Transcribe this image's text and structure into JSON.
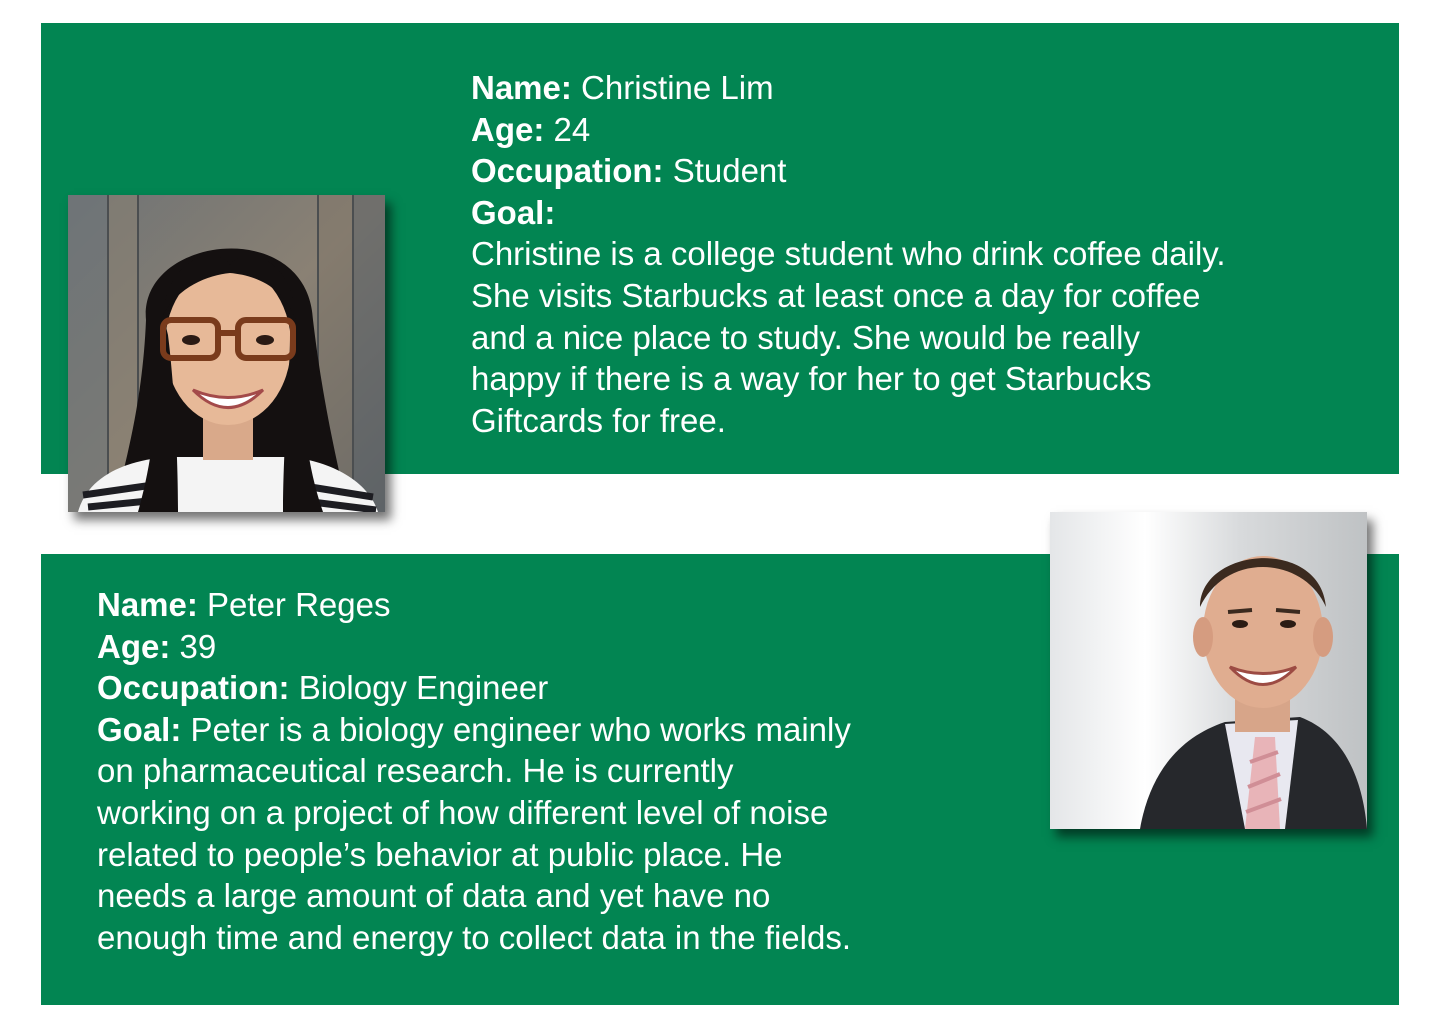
{
  "labels": {
    "name": "Name:",
    "age": "Age:",
    "occupation": "Occupation:",
    "goal": "Goal:"
  },
  "colors": {
    "card_green": "#028552",
    "text": "#ffffff"
  },
  "personas": [
    {
      "name": "Christine Lim",
      "age": "24",
      "occupation": "Student",
      "goal_lines": [
        "Christine is a college student who drink coffee daily.",
        "She visits Starbucks at least once a day for coffee",
        "and a nice place to study. She would be really",
        "happy if there is a way for her to get Starbucks",
        "Giftcards for free."
      ],
      "photo_icon": "portrait-photo-woman-with-glasses"
    },
    {
      "name": "Peter Reges",
      "age": "39",
      "occupation": "Biology Engineer",
      "goal_lines": [
        "Peter is a biology engineer who works mainly",
        "on pharmaceutical research. He is currently",
        "working on a project of how different level of noise",
        "related to people’s behavior at public place. He",
        "needs a large amount of data and yet have no",
        "enough time and energy to collect data in the fields."
      ],
      "photo_icon": "portrait-photo-man-in-suit"
    }
  ]
}
